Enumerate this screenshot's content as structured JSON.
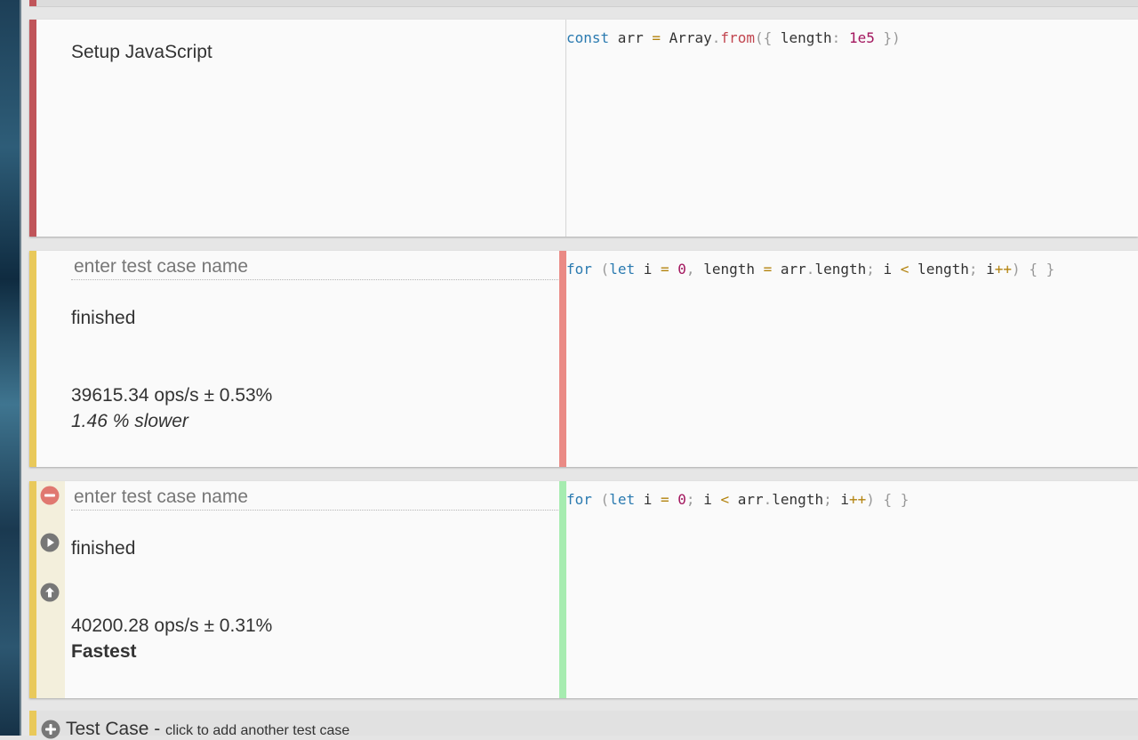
{
  "setup": {
    "title": "Setup JavaScript"
  },
  "test_cases": [
    {
      "name_placeholder": "enter test case name",
      "status": "finished",
      "ops": "39615.34 ops/s ± 0.53%",
      "relative": "1.46 % slower"
    },
    {
      "name_placeholder": "enter test case name",
      "status": "finished",
      "ops": "40200.28 ops/s ± 0.31%",
      "relative": "Fastest"
    }
  ],
  "add_case": {
    "label": "Test Case",
    "dash": " - ",
    "hint": "click to add another test case"
  },
  "icons": {
    "remove": "minus-circle-icon",
    "run": "play-circle-icon",
    "move_up": "arrow-up-circle-icon",
    "add": "plus-circle-icon"
  },
  "colors": {
    "setup_accent": "#c0555a",
    "case_accent": "#e9c95a",
    "slower_bar": "#ea8a85",
    "fastest_bar": "#a6ecb0",
    "tool_icon": "#777777",
    "remove_icon": "#e07870"
  }
}
